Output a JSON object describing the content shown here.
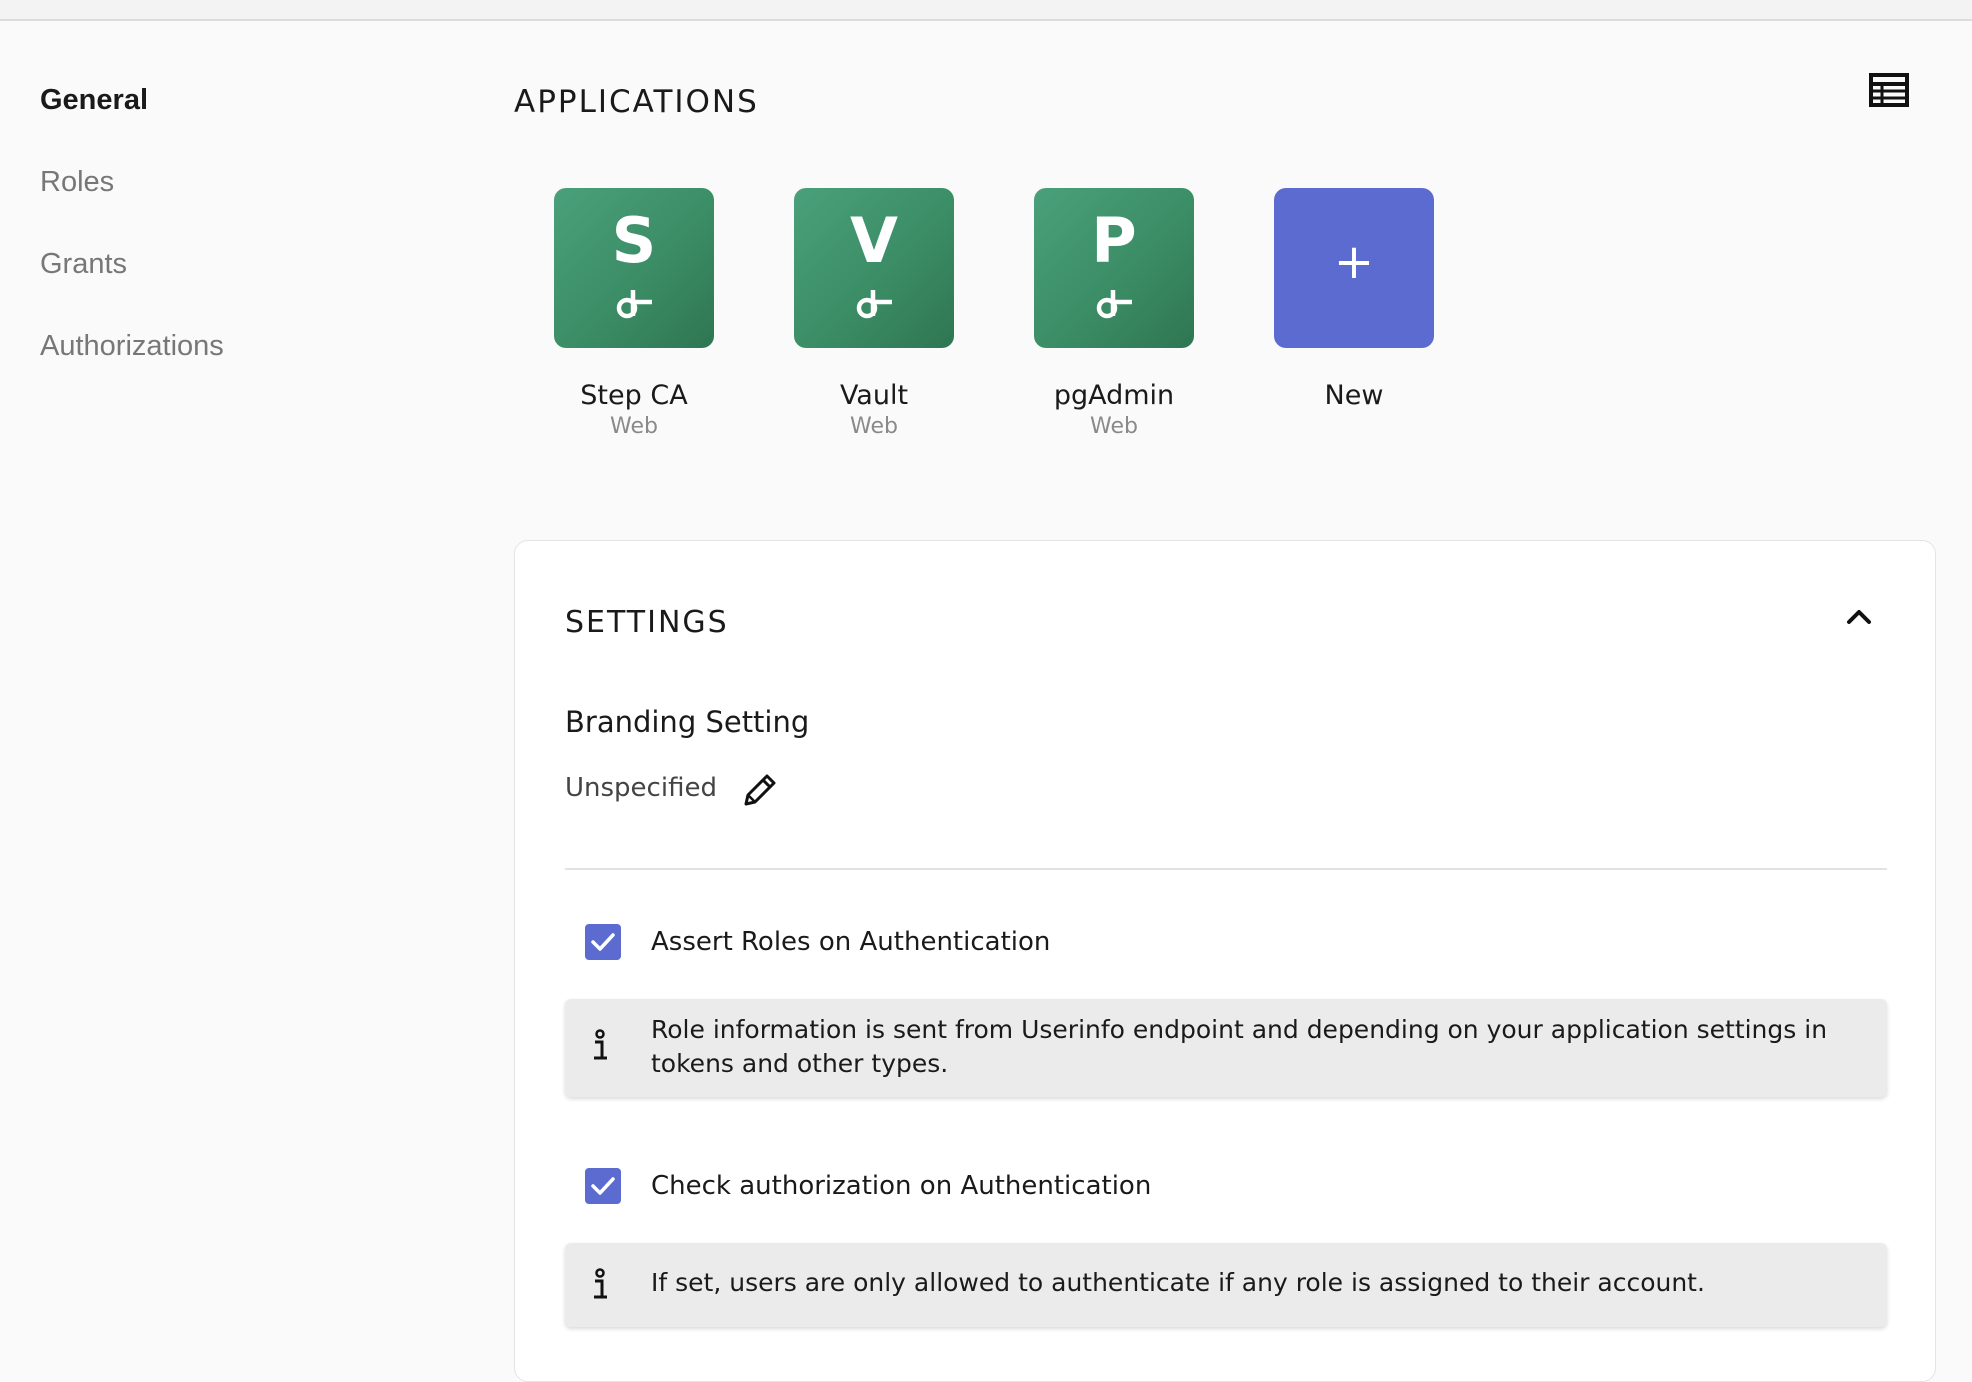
{
  "sidebar": {
    "items": [
      {
        "label": "General",
        "active": true
      },
      {
        "label": "Roles",
        "active": false
      },
      {
        "label": "Grants",
        "active": false
      },
      {
        "label": "Authorizations",
        "active": false
      }
    ]
  },
  "applications": {
    "title": "APPLICATIONS",
    "view_toggle_icon": "table-icon",
    "apps": [
      {
        "letter": "S",
        "name": "Step CA",
        "type": "Web",
        "color": "#3b8d66",
        "icon": "oidc-app-icon"
      },
      {
        "letter": "V",
        "name": "Vault",
        "type": "Web",
        "color": "#3b8d66",
        "icon": "oidc-app-icon"
      },
      {
        "letter": "P",
        "name": "pgAdmin",
        "type": "Web",
        "color": "#3b8d66",
        "icon": "oidc-app-icon"
      }
    ],
    "new_app": {
      "symbol": "+",
      "name": "New",
      "color": "#5c6bcf",
      "icon": "plus-icon"
    }
  },
  "settings": {
    "title": "SETTINGS",
    "collapse_icon": "chevron-up-icon",
    "branding": {
      "title": "Branding Setting",
      "value": "Unspecified",
      "edit_icon": "pencil-icon"
    },
    "options": [
      {
        "label": "Assert Roles on Authentication",
        "checked": true,
        "info": "Role information is sent from Userinfo endpoint and depending on your application settings in tokens and other types."
      },
      {
        "label": "Check authorization on Authentication",
        "checked": true,
        "info": "If set, users are only allowed to authenticate if any role is assigned to their account."
      }
    ]
  },
  "colors": {
    "accent": "#5c6bcf",
    "app_tile": "#3b8d66",
    "background": "#fafafa"
  }
}
